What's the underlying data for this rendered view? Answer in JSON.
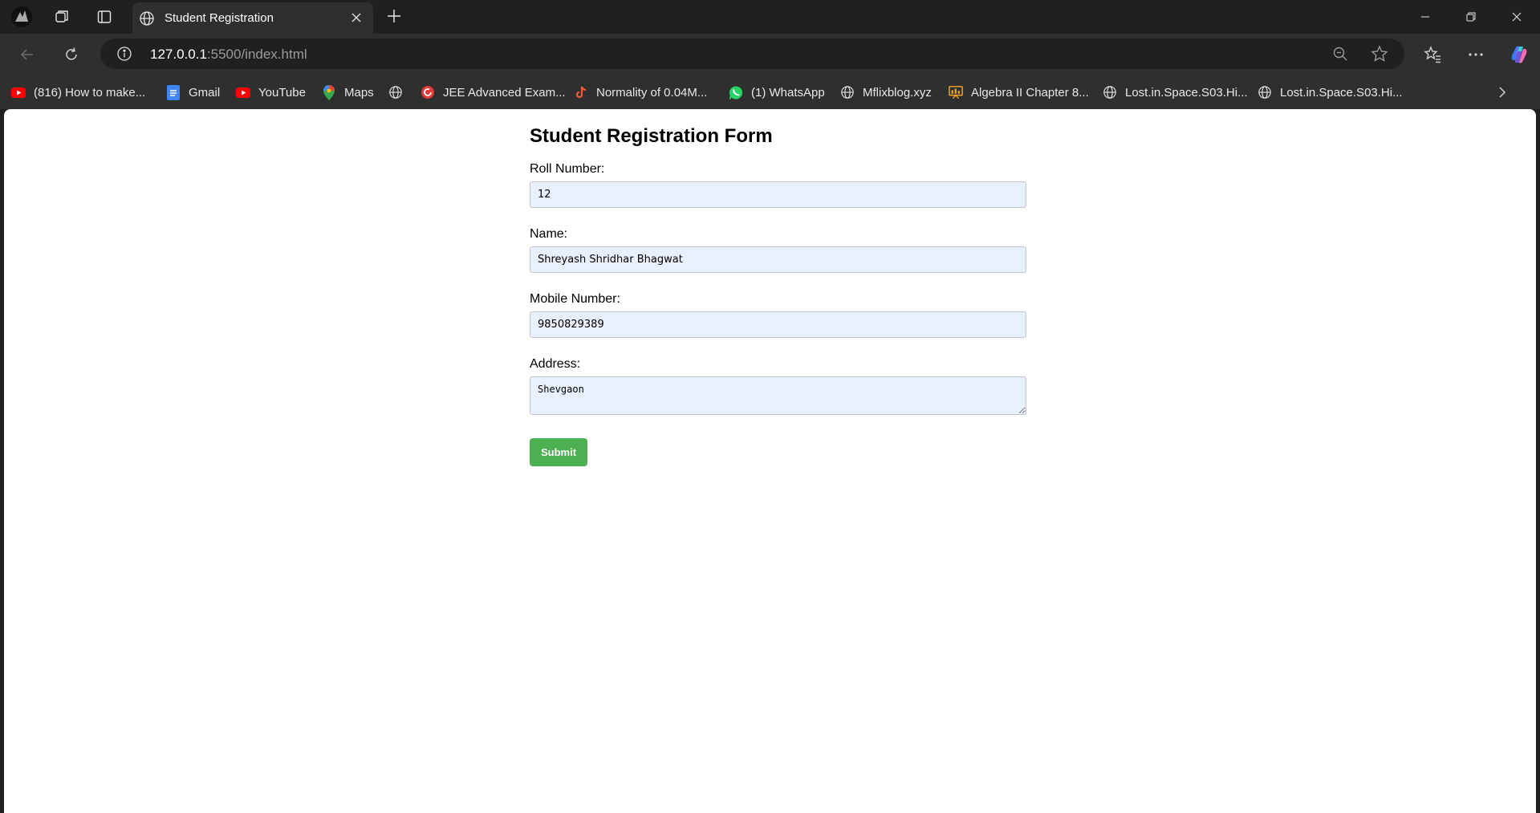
{
  "browser": {
    "tab_title": "Student Registration",
    "url_host": "127.0.0.1",
    "url_path": ":5500/index.html",
    "bookmarks": [
      {
        "label": "(816) How to make...",
        "icon": "youtube-icon"
      },
      {
        "label": "Gmail",
        "icon": "docs-icon"
      },
      {
        "label": "YouTube",
        "icon": "youtube-icon"
      },
      {
        "label": "Maps",
        "icon": "maps-pin-icon"
      },
      {
        "label": "",
        "icon": "globe-icon"
      },
      {
        "label": "JEE Advanced Exam...",
        "icon": "refresh-red-icon"
      },
      {
        "label": "Normality of 0.04M...",
        "icon": "tiktok-icon"
      },
      {
        "label": "(1) WhatsApp",
        "icon": "whatsapp-icon"
      },
      {
        "label": "Mflixblog.xyz",
        "icon": "globe-icon"
      },
      {
        "label": "Algebra II Chapter 8...",
        "icon": "presentation-icon"
      },
      {
        "label": "Lost.in.Space.S03.Hi...",
        "icon": "globe-icon"
      },
      {
        "label": "Lost.in.Space.S03.Hi...",
        "icon": "globe-icon"
      }
    ]
  },
  "form": {
    "title": "Student Registration Form",
    "roll_label": "Roll Number:",
    "roll_value": "12",
    "name_label": "Name:",
    "name_value": "Shreyash Shridhar Bhagwat",
    "mobile_label": "Mobile Number:",
    "mobile_value": "9850829389",
    "address_label": "Address:",
    "address_value": "Shevgaon",
    "submit_label": "Submit"
  },
  "colors": {
    "submit_bg": "#4caf50",
    "input_bg": "#e8f0fe",
    "chrome_bg": "#202020",
    "toolbar_bg": "#2f2f2f"
  }
}
